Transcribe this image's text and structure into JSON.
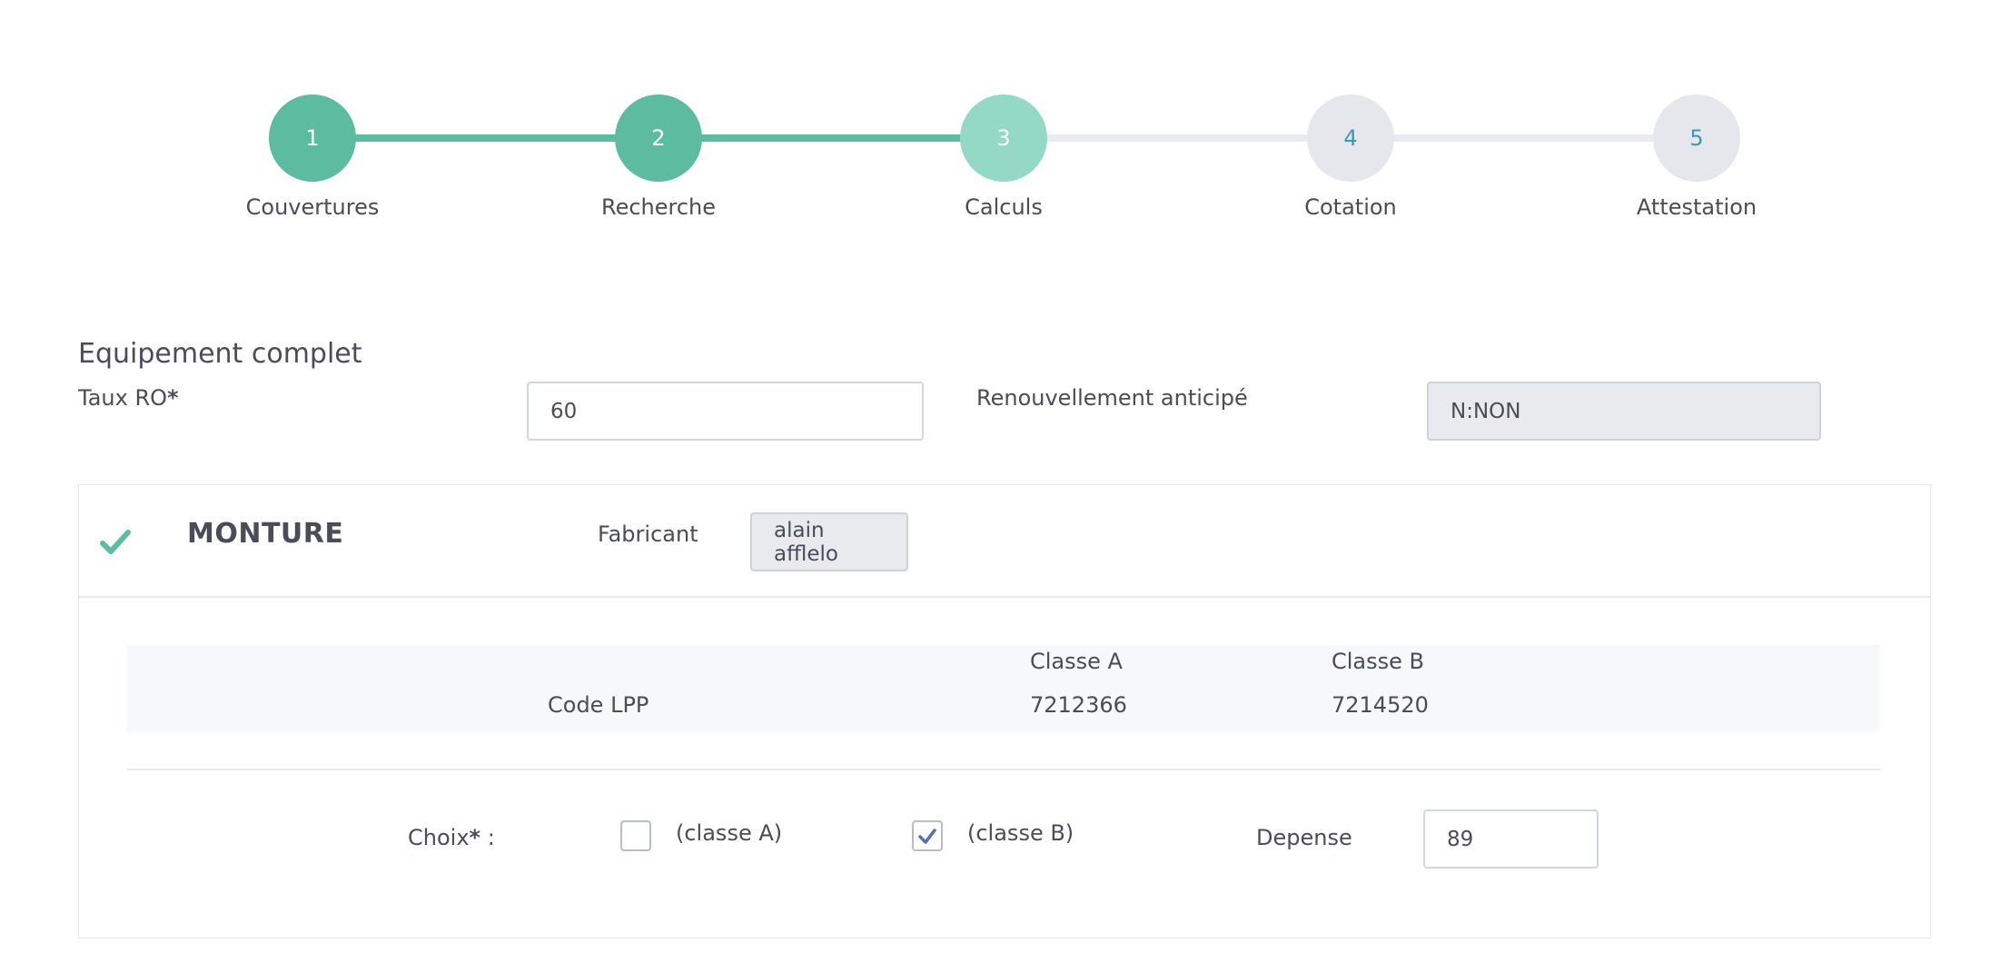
{
  "stepper": {
    "steps": [
      {
        "number": "1",
        "label": "Couvertures",
        "state": "done"
      },
      {
        "number": "2",
        "label": "Recherche",
        "state": "done"
      },
      {
        "number": "3",
        "label": "Calculs",
        "state": "current"
      },
      {
        "number": "4",
        "label": "Cotation",
        "state": "todo"
      },
      {
        "number": "5",
        "label": "Attestation",
        "state": "todo"
      }
    ]
  },
  "section": {
    "title": "Equipement complet",
    "taux_label": "Taux RO",
    "required_mark": "*",
    "taux_value": "60",
    "renouvellement_label": "Renouvellement anticipé",
    "renouvellement_value": "N:NON"
  },
  "monture": {
    "title": "MONTURE",
    "fabricant_label": "Fabricant",
    "fabricant_value": "alain afflelo",
    "table": {
      "row_label": "Code LPP",
      "col_a": "Classe A",
      "col_b": "Classe B",
      "value_a": "7212366",
      "value_b": "7214520"
    },
    "choix_label": "Choix",
    "choix_required": "*",
    "choix_suffix": " :",
    "option_a_label": "(classe A)",
    "option_a_checked": false,
    "option_b_label": "(classe B)",
    "option_b_checked": true,
    "depense_label": "Depense",
    "depense_value": "89"
  },
  "colors": {
    "step_done": "#5dbb9f",
    "step_current": "#93d9c6",
    "step_todo": "#e5e7ed",
    "check": "#5dbb9f"
  }
}
